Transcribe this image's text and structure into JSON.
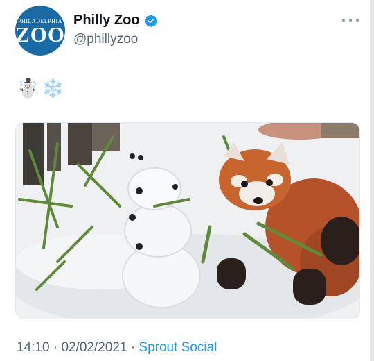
{
  "profile": {
    "avatar_top_text": "PHILADELPHIA",
    "avatar_main_text": "ZOO",
    "display_name": "Philly Zoo",
    "handle": "@phillyzoo",
    "verified": true
  },
  "tweet": {
    "emojis": [
      "☃️",
      "❄️"
    ],
    "media_description_icon": "photo"
  },
  "footer": {
    "time": "14:10",
    "date": "02/02/2021",
    "separator": "·",
    "source": "Sprout Social"
  },
  "colors": {
    "accent": "#1d9bf0",
    "avatar_bg": "#1a6aa6",
    "text_primary": "#0f1419",
    "text_secondary": "#536471"
  }
}
